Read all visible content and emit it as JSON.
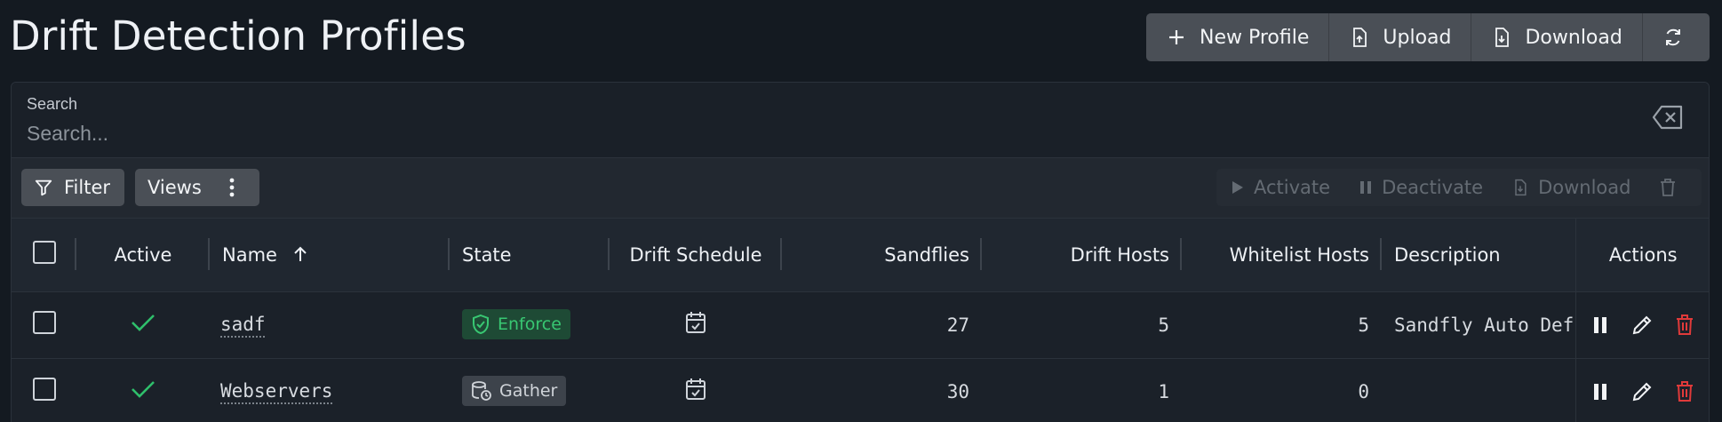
{
  "page": {
    "title": "Drift Detection Profiles"
  },
  "top_actions": {
    "new_profile": "New Profile",
    "upload": "Upload",
    "download": "Download"
  },
  "search": {
    "label": "Search",
    "placeholder": "Search..."
  },
  "toolbar": {
    "filter": "Filter",
    "views": "Views",
    "activate": "Activate",
    "deactivate": "Deactivate",
    "download": "Download"
  },
  "table": {
    "headers": {
      "active": "Active",
      "name": "Name",
      "state": "State",
      "drift_schedule": "Drift Schedule",
      "sandflies": "Sandflies",
      "drift_hosts": "Drift Hosts",
      "whitelist_hosts": "Whitelist Hosts",
      "description": "Description",
      "actions": "Actions"
    },
    "rows": [
      {
        "active": true,
        "name": "sadf",
        "state": "Enforce",
        "sandflies": "27",
        "drift_hosts": "5",
        "whitelist_hosts": "5",
        "description": "Sandfly Auto Def"
      },
      {
        "active": true,
        "name": "Webservers",
        "state": "Gather",
        "sandflies": "30",
        "drift_hosts": "1",
        "whitelist_hosts": "0",
        "description": ""
      }
    ]
  },
  "colors": {
    "check_green": "#2fbf6b",
    "delete_red": "#e03a3a",
    "enforce_green": "#38c772"
  }
}
